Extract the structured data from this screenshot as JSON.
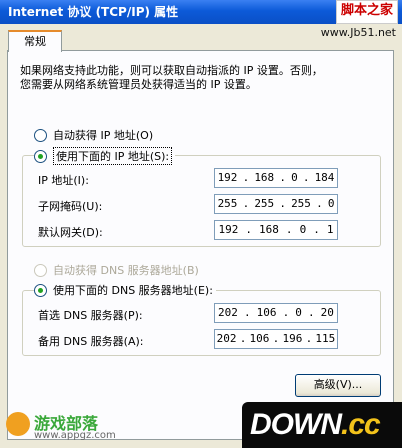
{
  "window": {
    "title": "Internet 协议 (TCP/IP) 属性",
    "watermark": "脚本之家",
    "watermark_url": "www.Jb51.net"
  },
  "tab": {
    "label": "常规"
  },
  "description": [
    "如果网络支持此功能，则可以获取自动指派的 IP 设置。否则，",
    "您需要从网络系统管理员处获得适当的 IP 设置。"
  ],
  "ip": {
    "auto_label": "自动获得 IP 地址(O)",
    "manual_label": "使用下面的 IP 地址(S):",
    "fields": [
      {
        "label": "IP 地址(I):",
        "value": [
          "192",
          "168",
          "0",
          "184"
        ]
      },
      {
        "label": "子网掩码(U):",
        "value": [
          "255",
          "255",
          "255",
          "0"
        ]
      },
      {
        "label": "默认网关(D):",
        "value": [
          "192",
          "168",
          "0",
          "1"
        ]
      }
    ]
  },
  "dns": {
    "auto_label": "自动获得 DNS 服务器地址(B)",
    "manual_label": "使用下面的 DNS 服务器地址(E):",
    "fields": [
      {
        "label": "首选 DNS 服务器(P):",
        "value": [
          "202",
          "106",
          "0",
          "20"
        ]
      },
      {
        "label": "备用 DNS 服务器(A):",
        "value": [
          "202",
          "106",
          "196",
          "115"
        ]
      }
    ]
  },
  "buttons": {
    "advanced": "高级(V)..."
  },
  "logos": {
    "left_main": "游戏部落",
    "left_sub": "www.appgz.com",
    "right_down": "DOWN",
    "right_cc": ".cc"
  }
}
